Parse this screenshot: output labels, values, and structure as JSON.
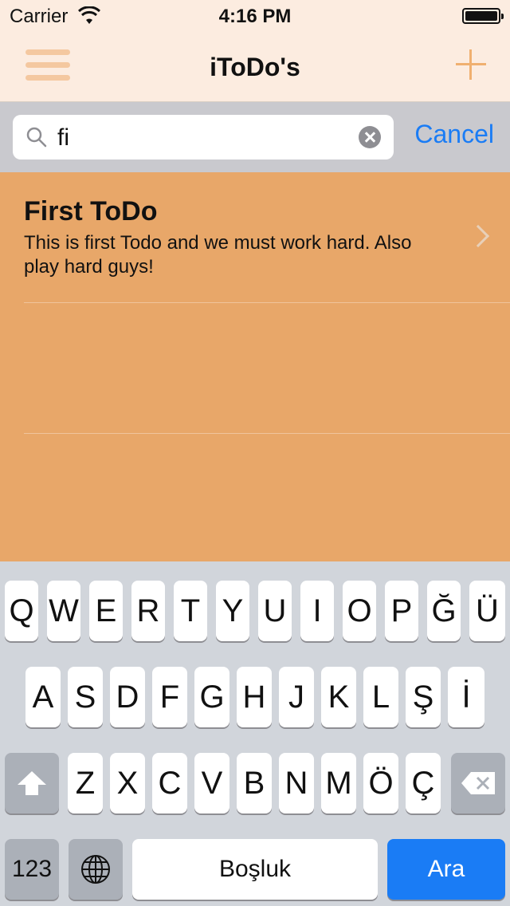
{
  "status": {
    "carrier": "Carrier",
    "time": "4:16 PM"
  },
  "nav": {
    "title": "iToDo's",
    "menu_icon": "hamburger-icon",
    "add_icon": "plus-icon"
  },
  "search": {
    "value": "fi",
    "cancel_label": "Cancel"
  },
  "todos": [
    {
      "title": "First ToDo",
      "description": "This is first Todo and we must work hard. Also play hard guys!"
    }
  ],
  "keyboard": {
    "row1": [
      "Q",
      "W",
      "E",
      "R",
      "T",
      "Y",
      "U",
      "I",
      "O",
      "P",
      "Ğ",
      "Ü"
    ],
    "row2": [
      "A",
      "S",
      "D",
      "F",
      "G",
      "H",
      "J",
      "K",
      "L",
      "Ş",
      "İ"
    ],
    "row3": [
      "Z",
      "X",
      "C",
      "V",
      "B",
      "N",
      "M",
      "Ö",
      "Ç"
    ],
    "numbers_label": "123",
    "space_label": "Boşluk",
    "return_label": "Ara"
  },
  "colors": {
    "accent": "#1a7cf5",
    "list_bg": "#e8a769",
    "nav_bg": "#fcece0"
  }
}
